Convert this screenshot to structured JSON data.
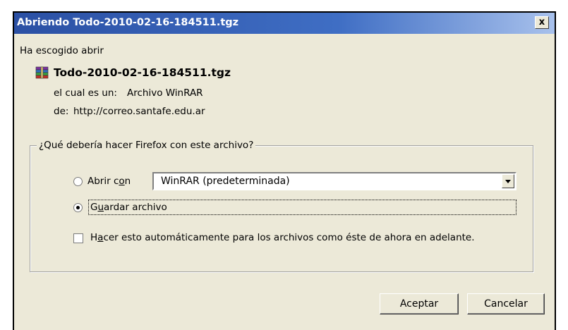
{
  "window": {
    "title": "Abriendo Todo-2010-02-16-184511.tgz",
    "close_label": "x"
  },
  "dialog": {
    "intro": "Ha escogido abrir",
    "file_name": "Todo-2010-02-16-184511.tgz",
    "file_icon": "winrar-archive-icon",
    "type_label": "el cual es un:",
    "type_value": "Archivo WinRAR",
    "from_label": "de:",
    "from_value": "http://correo.santafe.edu.ar"
  },
  "action_group": {
    "legend": "¿Qué debería hacer Firefox con este archivo?",
    "open_with": {
      "label_before": "Abrir c",
      "label_mnemonic": "o",
      "label_after": "n",
      "selected": false,
      "app": "WinRAR (predeterminada)"
    },
    "save_file": {
      "label_before": "G",
      "label_mnemonic": "u",
      "label_after": "ardar archivo",
      "selected": true
    },
    "auto": {
      "label_before": "H",
      "label_mnemonic": "a",
      "label_after": "cer esto automáticamente para los archivos como éste de ahora en adelante.",
      "checked": false
    }
  },
  "buttons": {
    "accept": "Aceptar",
    "cancel": "Cancelar"
  },
  "colors": {
    "titlebar_start": "#2b50a4",
    "titlebar_end": "#a8c1ec",
    "dialog_bg": "#ece9d8"
  }
}
